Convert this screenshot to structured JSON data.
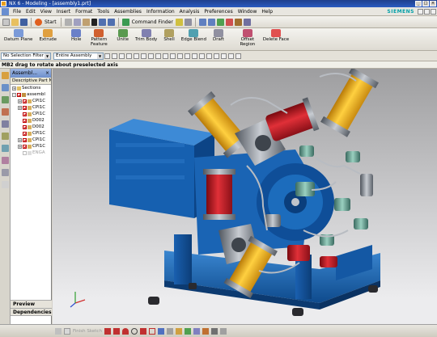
{
  "titlebar": {
    "title": "NX 6 - Modeling - [assembly1.prt]"
  },
  "menu": {
    "items": [
      "File",
      "Edit",
      "View",
      "Insert",
      "Format",
      "Tools",
      "Assemblies",
      "Information",
      "Analysis",
      "Preferences",
      "Window",
      "Help"
    ],
    "brand": "SIEMENS"
  },
  "toolbar1": {
    "start_label": "Start",
    "command_finder_label": "Command Finder"
  },
  "features": [
    {
      "label": "Datum Plane",
      "icon": "datum-plane-icon",
      "color": "#7a9ad8"
    },
    {
      "label": "Extrude",
      "icon": "extrude-icon",
      "color": "#e0a040"
    },
    {
      "label": "Hole",
      "icon": "hole-icon",
      "color": "#6a80c8"
    },
    {
      "label": "Pattern Feature",
      "icon": "pattern-icon",
      "color": "#d06030"
    },
    {
      "label": "Unite",
      "icon": "unite-icon",
      "color": "#5a9a50"
    },
    {
      "label": "Trim Body",
      "icon": "trim-body-icon",
      "color": "#8080b0"
    },
    {
      "label": "Shell",
      "icon": "shell-icon",
      "color": "#b0a060"
    },
    {
      "label": "Edge Blend",
      "icon": "edge-blend-icon",
      "color": "#50a0b0"
    },
    {
      "label": "Draft",
      "icon": "draft-icon",
      "color": "#9090a0"
    },
    {
      "label": "Offset Region",
      "icon": "offset-region-icon",
      "color": "#c05070"
    },
    {
      "label": "Delete Face",
      "icon": "delete-face-icon",
      "color": "#e05050"
    }
  ],
  "selection": {
    "filter_value": "No Selection Filter",
    "scope_value": "Entire Assembly"
  },
  "cue_line": "MB2 drag to rotate about preselected axis",
  "navigator": {
    "title": "Assembl...",
    "column_header": "Descriptive Part N",
    "rows": [
      {
        "label": "Sections",
        "type": "folder",
        "expander": "+",
        "checked": false
      },
      {
        "label": "assembl",
        "type": "assembly",
        "expander": "-",
        "checked": true
      },
      {
        "label": "CPI1C",
        "type": "part",
        "expander": "+",
        "checked": true
      },
      {
        "label": "CPI1C",
        "type": "part",
        "expander": "+",
        "checked": true
      },
      {
        "label": "CPI1C",
        "type": "part",
        "expander": "",
        "checked": true
      },
      {
        "label": "D002",
        "type": "part",
        "expander": "",
        "checked": true
      },
      {
        "label": "D002",
        "type": "part",
        "expander": "",
        "checked": true
      },
      {
        "label": "CPI1C",
        "type": "part",
        "expander": "",
        "checked": true
      },
      {
        "label": "CPI1C",
        "type": "part",
        "expander": "+",
        "checked": true
      },
      {
        "label": "CPI1C",
        "type": "part",
        "expander": "+",
        "checked": true
      },
      {
        "label": "ENGA",
        "type": "part",
        "expander": "",
        "checked": false,
        "dim": true
      }
    ],
    "preview_label": "Preview",
    "dependencies_label": "Dependencies"
  },
  "bottombar": {
    "finish_sketch_label": "Finish Sketch"
  },
  "colors": {
    "frame_blue": "#1c5fa8",
    "cylinder_yellow": "#f0b020",
    "housing_red": "#c8202a",
    "steel_gray": "#8a9098"
  }
}
